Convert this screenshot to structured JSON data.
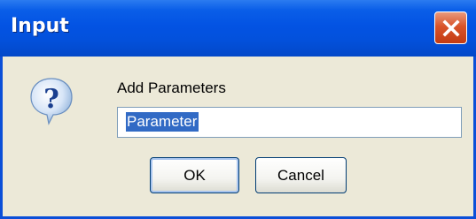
{
  "window": {
    "title": "Input",
    "close_icon": "close-icon"
  },
  "dialog": {
    "icon": "question-icon",
    "prompt": "Add Parameters",
    "input_value": "Parameter",
    "ok_label": "OK",
    "cancel_label": "Cancel"
  },
  "colors": {
    "titlebar": "#0353e3",
    "close_button": "#d9542a",
    "selection": "#316ac5",
    "dialog_background": "#ece9d8"
  }
}
